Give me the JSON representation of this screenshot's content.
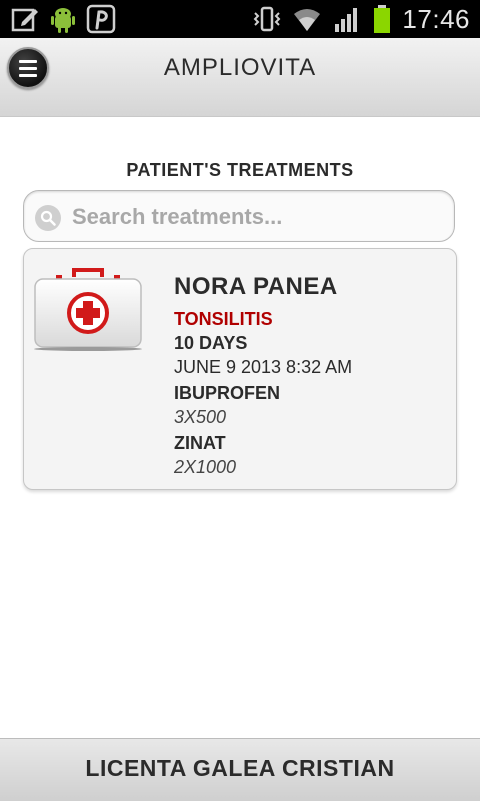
{
  "status_bar": {
    "time": "17:46",
    "icons": [
      "edit-icon",
      "android-icon",
      "pinterest-icon",
      "vibrate-icon",
      "wifi-icon",
      "signal-icon",
      "battery-icon"
    ]
  },
  "header": {
    "title": "AMPLIOVITA"
  },
  "section": {
    "title": "PATIENT'S TREATMENTS"
  },
  "search": {
    "placeholder": "Search treatments..."
  },
  "treatment": {
    "patient_name": "NORA PANEA",
    "diagnosis": "TONSILITIS",
    "duration": "10 DAYS",
    "date": "JUNE 9 2013 8:32 AM",
    "medications": [
      {
        "name": "IBUPROFEN",
        "dose": "3X500"
      },
      {
        "name": "ZINAT",
        "dose": "2X1000"
      }
    ]
  },
  "footer": {
    "text": "LICENTA GALEA CRISTIAN"
  },
  "colors": {
    "diagnosis": "#b00000",
    "statusbar_bg": "#000000",
    "battery": "#8bd600"
  }
}
